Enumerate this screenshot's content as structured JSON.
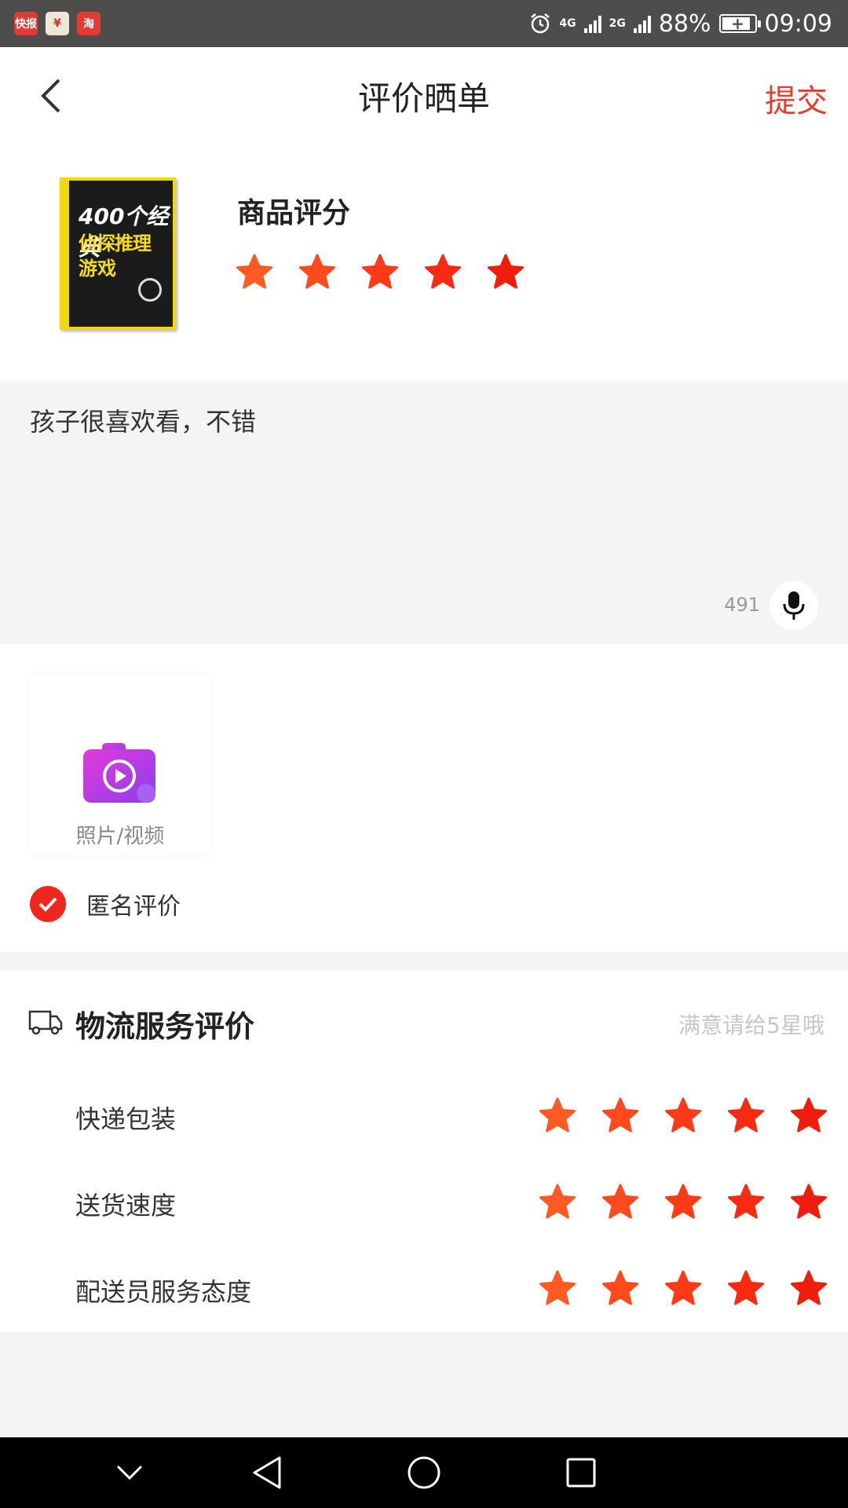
{
  "status_bar": {
    "notifications": [
      "快报",
      "¥",
      "淘"
    ],
    "network_1": "4G",
    "network_2": "2G",
    "battery": "88%",
    "battery_level": 0.88,
    "time": "09:09",
    "icons": [
      "alarm-icon",
      "signal-icon",
      "battery-charging-icon"
    ]
  },
  "header": {
    "title": "评价晒单",
    "submit_label": "提交",
    "back_icon": "chevron-left-icon"
  },
  "product": {
    "cover_line1": "400个经典",
    "cover_line2": "侦探推理",
    "cover_line3": "游戏",
    "rating_title": "商品评分",
    "rating": 5,
    "max_rating": 5
  },
  "comment": {
    "text": "孩子很喜欢看，不错",
    "remaining_chars": "491",
    "mic_icon": "microphone-icon"
  },
  "media": {
    "upload_label": "照片/视频",
    "upload_icon": "camera-video-icon"
  },
  "anonymous": {
    "label": "匿名评价",
    "checked": true
  },
  "logistics": {
    "title": "物流服务评价",
    "hint": "满意请给5星哦",
    "icon": "truck-icon",
    "rows": [
      {
        "label": "快递包装",
        "rating": 5
      },
      {
        "label": "送货速度",
        "rating": 5
      },
      {
        "label": "配送员服务态度",
        "rating": 5
      }
    ]
  },
  "colors": {
    "accent": "#e93b2e",
    "star_colors": [
      "#ff5a24",
      "#ff4a1e",
      "#ff3a17",
      "#f72a12",
      "#ee1d0e"
    ]
  },
  "nav_bar": {
    "buttons": [
      "chevron-down-icon",
      "back-triangle-icon",
      "home-circle-icon",
      "recents-square-icon"
    ]
  }
}
